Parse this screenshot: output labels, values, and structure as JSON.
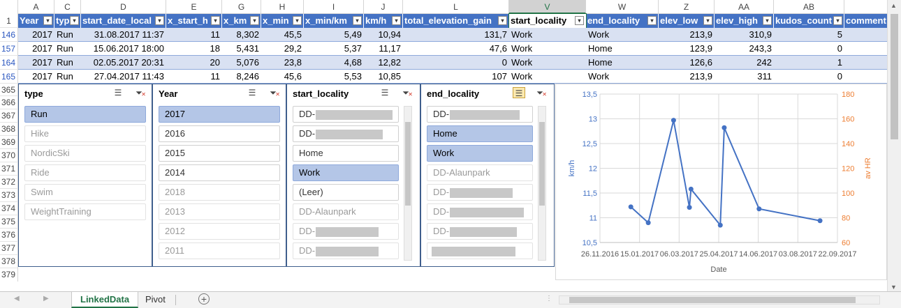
{
  "columns": [
    "A",
    "C",
    "D",
    "E",
    "G",
    "H",
    "I",
    "J",
    "L",
    "V",
    "W",
    "Z",
    "AA",
    "AB"
  ],
  "selected_column": "V",
  "table": {
    "header_row": "1",
    "headers": [
      "Year",
      "typ",
      "start_date_local",
      "x_start_h",
      "x_km",
      "x_min",
      "x_min/km",
      "km/h",
      "total_elevation_gain",
      "start_locality",
      "end_locality",
      "elev_low",
      "elev_high",
      "kudos_count",
      "comment"
    ],
    "rows": [
      {
        "num": "146",
        "cells": [
          "2017",
          "Run",
          "31.08.2017 11:37",
          "11",
          "8,302",
          "45,5",
          "5,49",
          "10,94",
          "131,7",
          "Work",
          "Work",
          "213,9",
          "310,9",
          "5"
        ]
      },
      {
        "num": "157",
        "cells": [
          "2017",
          "Run",
          "15.06.2017 18:00",
          "18",
          "5,431",
          "29,2",
          "5,37",
          "11,17",
          "47,6",
          "Work",
          "Home",
          "123,9",
          "243,3",
          "0"
        ]
      },
      {
        "num": "164",
        "cells": [
          "2017",
          "Run",
          "02.05.2017 20:31",
          "20",
          "5,076",
          "23,8",
          "4,68",
          "12,82",
          "0",
          "Work",
          "Home",
          "126,6",
          "242",
          "1"
        ]
      },
      {
        "num": "165",
        "cells": [
          "2017",
          "Run",
          "27.04.2017 11:43",
          "11",
          "8,246",
          "45,6",
          "5,53",
          "10,85",
          "107",
          "Work",
          "Work",
          "213,9",
          "311",
          "0"
        ]
      }
    ]
  },
  "row_numbers": [
    "365",
    "366",
    "367",
    "368",
    "369",
    "370",
    "371",
    "372",
    "373",
    "374",
    "375",
    "376",
    "377",
    "378",
    "379"
  ],
  "slicers": {
    "type": {
      "title": "type",
      "items": [
        {
          "label": "Run",
          "state": "sel"
        },
        {
          "label": "Hike",
          "state": "dim"
        },
        {
          "label": "NordicSki",
          "state": "dim"
        },
        {
          "label": "Ride",
          "state": "dim"
        },
        {
          "label": "Swim",
          "state": "dim"
        },
        {
          "label": "WeightTraining",
          "state": "dim"
        }
      ]
    },
    "year": {
      "title": "Year",
      "items": [
        {
          "label": "2017",
          "state": "sel"
        },
        {
          "label": "2016",
          "state": "norm"
        },
        {
          "label": "2015",
          "state": "norm"
        },
        {
          "label": "2014",
          "state": "norm"
        },
        {
          "label": "2018",
          "state": "dim"
        },
        {
          "label": "2013",
          "state": "dim"
        },
        {
          "label": "2012",
          "state": "dim"
        },
        {
          "label": "2011",
          "state": "dim"
        }
      ]
    },
    "start_locality": {
      "title": "start_locality",
      "items": [
        {
          "label": "DD-",
          "state": "norm"
        },
        {
          "label": "DD-",
          "state": "norm"
        },
        {
          "label": "Home",
          "state": "norm"
        },
        {
          "label": "Work",
          "state": "sel"
        },
        {
          "label": "(Leer)",
          "state": "norm"
        },
        {
          "label": "DD-Alaunpark",
          "state": "dim"
        },
        {
          "label": "DD-",
          "state": "dim"
        },
        {
          "label": "DD-",
          "state": "dim"
        }
      ]
    },
    "end_locality": {
      "title": "end_locality",
      "items": [
        {
          "label": "DD-",
          "state": "norm"
        },
        {
          "label": "Home",
          "state": "sel"
        },
        {
          "label": "Work",
          "state": "sel"
        },
        {
          "label": "DD-Alaunpark",
          "state": "dim"
        },
        {
          "label": "DD-",
          "state": "dim"
        },
        {
          "label": "DD-",
          "state": "dim"
        },
        {
          "label": "DD-",
          "state": "dim"
        },
        {
          "label": "",
          "state": "dim"
        }
      ]
    }
  },
  "chart_data": {
    "type": "line",
    "title": "",
    "xlabel": "Date",
    "ylabel": "km/h",
    "y2label": "av HR",
    "x_ticks": [
      "26.11.2016",
      "15.01.2017",
      "06.03.2017",
      "25.04.2017",
      "14.06.2017",
      "03.08.2017",
      "22.09.2017"
    ],
    "y_ticks": [
      "10,5",
      "11",
      "11,5",
      "12",
      "12,5",
      "13",
      "13,5"
    ],
    "y2_ticks": [
      "60",
      "80",
      "100",
      "120",
      "140",
      "160",
      "180"
    ],
    "ylim": [
      10.5,
      13.5
    ],
    "y2lim": [
      60,
      180
    ],
    "grid": true,
    "series": [
      {
        "values": [
          {
            "x": "2017-01-04",
            "y": 11.22
          },
          {
            "x": "2017-01-26",
            "y": 10.9
          },
          {
            "x": "2017-02-27",
            "y": 12.97
          },
          {
            "x": "2017-03-19",
            "y": 11.21
          },
          {
            "x": "2017-03-21",
            "y": 11.58
          },
          {
            "x": "2017-04-27",
            "y": 10.85
          },
          {
            "x": "2017-05-02",
            "y": 12.82
          },
          {
            "x": "2017-06-15",
            "y": 11.18
          },
          {
            "x": "2017-08-31",
            "y": 10.94
          }
        ]
      }
    ],
    "colors": {
      "primary": "#4472c4",
      "secondary_axis": "#ed7d31"
    }
  },
  "tabs": [
    {
      "label": "LinkedData",
      "active": true
    },
    {
      "label": "Pivot",
      "active": false
    }
  ],
  "add_sheet_icon": "plus-circle-icon"
}
